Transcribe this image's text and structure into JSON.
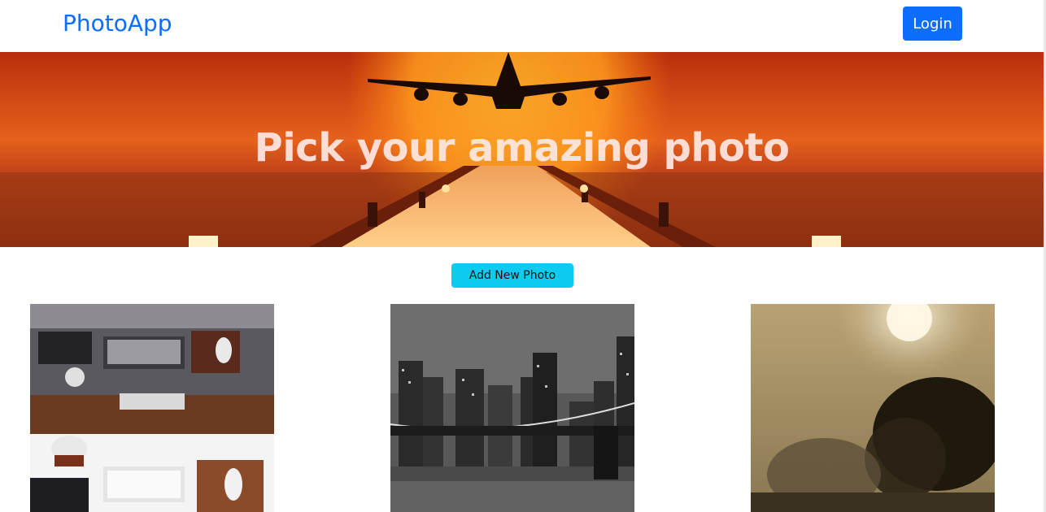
{
  "navbar": {
    "brand": "PhotoApp",
    "login_label": "Login"
  },
  "hero": {
    "title": "Pick your amazing photo"
  },
  "actions": {
    "add_photo_label": "Add New Photo"
  },
  "photos": [
    {
      "subject": "desk workspace with keyboard, mouse and coffee mug"
    },
    {
      "subject": "black and white city skyline with bridge at night"
    },
    {
      "subject": "foggy sepia landscape with tree silhouette and sun"
    }
  ],
  "colors": {
    "primary": "#0d6efd",
    "info": "#0dcaf0",
    "hero_sunset": "#e8661a"
  }
}
